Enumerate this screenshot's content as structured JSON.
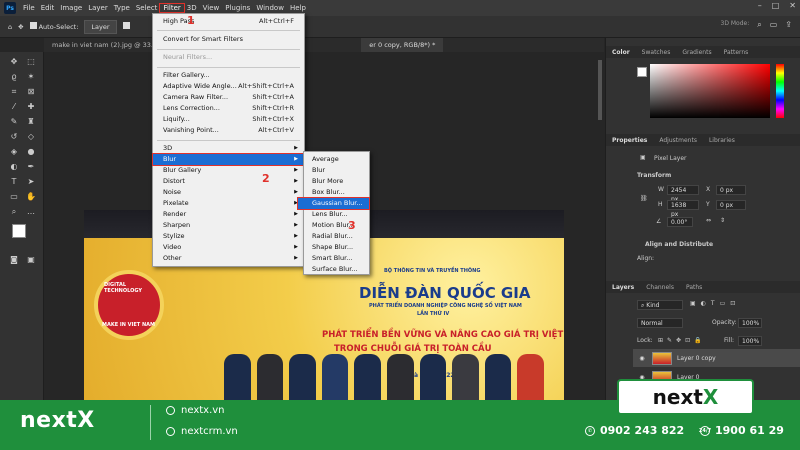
{
  "menubar": {
    "app_icon": "Ps",
    "items": [
      "File",
      "Edit",
      "Image",
      "Layer",
      "Type",
      "Select",
      "Filter",
      "3D",
      "View",
      "Plugins",
      "Window",
      "Help"
    ],
    "window_controls": [
      "–",
      "□",
      "✕"
    ]
  },
  "options_bar": {
    "auto_select": "Auto-Select:",
    "auto_select_target": "Layer",
    "mode_3d": "3D Mode:"
  },
  "tabs": {
    "doc1": "make in viet nam (2).jpg @ 33.3%",
    "doc2": "er 0 copy, RGB/8*) *"
  },
  "filter_menu": {
    "items": [
      {
        "label": "High Pass",
        "shortcut": "Alt+Ctrl+F"
      },
      {
        "label": "Convert for Smart Filters",
        "shortcut": ""
      },
      {
        "label": "Neural Filters...",
        "shortcut": "",
        "disabled": true
      },
      {
        "label": "Filter Gallery...",
        "shortcut": ""
      },
      {
        "label": "Adaptive Wide Angle...",
        "shortcut": "Alt+Shift+Ctrl+A"
      },
      {
        "label": "Camera Raw Filter...",
        "shortcut": "Shift+Ctrl+A"
      },
      {
        "label": "Lens Correction...",
        "shortcut": "Shift+Ctrl+R"
      },
      {
        "label": "Liquify...",
        "shortcut": "Shift+Ctrl+X"
      },
      {
        "label": "Vanishing Point...",
        "shortcut": "Alt+Ctrl+V"
      },
      {
        "label": "3D",
        "shortcut": ""
      },
      {
        "label": "Blur",
        "shortcut": ""
      },
      {
        "label": "Blur Gallery",
        "shortcut": ""
      },
      {
        "label": "Distort",
        "shortcut": ""
      },
      {
        "label": "Noise",
        "shortcut": ""
      },
      {
        "label": "Pixelate",
        "shortcut": ""
      },
      {
        "label": "Render",
        "shortcut": ""
      },
      {
        "label": "Sharpen",
        "shortcut": ""
      },
      {
        "label": "Stylize",
        "shortcut": ""
      },
      {
        "label": "Video",
        "shortcut": ""
      },
      {
        "label": "Other",
        "shortcut": ""
      }
    ]
  },
  "blur_submenu": {
    "items": [
      "Average",
      "Blur",
      "Blur More",
      "Box Blur...",
      "Gaussian Blur...",
      "Lens Blur...",
      "Motion Blur...",
      "Radial Blur...",
      "Shape Blur...",
      "Smart Blur...",
      "Surface Blur..."
    ]
  },
  "step_numbers": [
    "1",
    "2",
    "3"
  ],
  "poster": {
    "ministry": "BỘ THÔNG TIN VÀ TRUYỀN THÔNG",
    "title": "DIỄN ĐÀN QUỐC GIA",
    "subtitle": "PHÁT TRIỂN DOANH NGHIỆP CÔNG NGHỆ SỐ VIỆT NAM",
    "edition": "LẦN THỨ IV",
    "slogan1": "PHÁT TRIỂN BỀN VỮNG VÀ NÂNG CAO GIÁ TRỊ VIỆT",
    "slogan2": "TRONG CHUỖI GIÁ TRỊ TOÀN CẦU",
    "date": "Hà N    12.2022",
    "logo_top": "DIGITAL TECHNOLOGY",
    "logo_bottom": "MAKE IN VIET NAM"
  },
  "right_panel": {
    "color_tabs": [
      "Color",
      "Swatches",
      "Gradients",
      "Patterns"
    ],
    "prop_tabs": [
      "Properties",
      "Adjustments",
      "Libraries"
    ],
    "pixel_layer": "Pixel Layer",
    "transform": "Transform",
    "w_label": "W",
    "w_value": "2454 px",
    "h_label": "H",
    "h_value": "1638 px",
    "x_label": "X",
    "x_value": "0 px",
    "y_label": "Y",
    "y_value": "0 px",
    "angle": "0.00°",
    "align_header": "Align and Distribute",
    "align_label": "Align:",
    "layers_tabs": [
      "Layers",
      "Channels",
      "Paths"
    ],
    "kind": "Kind",
    "blend_mode": "Normal",
    "opacity_label": "Opacity:",
    "opacity_value": "100%",
    "lock_label": "Lock:",
    "fill_label": "Fill:",
    "fill_value": "100%",
    "layers": [
      "Layer 0 copy",
      "Layer 0"
    ]
  },
  "footer": {
    "brand": "nextX",
    "links": [
      "nextx.vn",
      "nextcrm.vn"
    ],
    "box_brand_a": "next",
    "box_brand_b": "X",
    "phone1": "0902 243 822",
    "phone2": "1900 61 29",
    "hotline_badge": "24/7"
  },
  "colors": {
    "accent_red": "#e0312b",
    "menu_highlight": "#1b6dd3",
    "footer_green": "#1f8f3c"
  }
}
